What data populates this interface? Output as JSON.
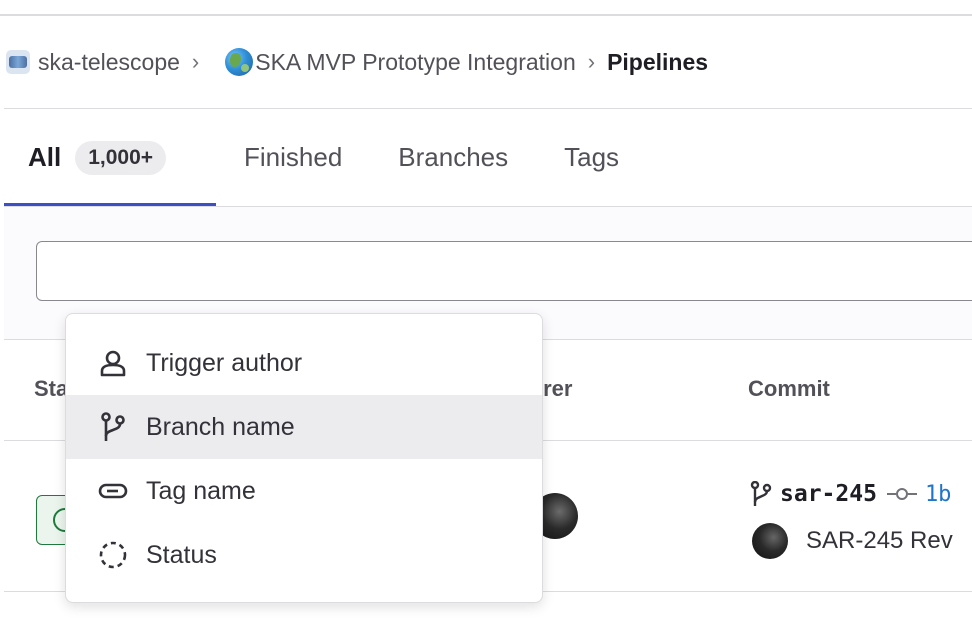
{
  "breadcrumb": {
    "items": [
      {
        "label": "ska-telescope",
        "avatar": "ska-telescope-avatar"
      },
      {
        "label": "SKA MVP Prototype Integration",
        "avatar": "globe-avatar"
      },
      {
        "label": "Pipelines"
      }
    ],
    "separator_icon": "chevron-right-icon"
  },
  "tabs": [
    {
      "label": "All",
      "count": "1,000+",
      "active": true
    },
    {
      "label": "Finished"
    },
    {
      "label": "Branches"
    },
    {
      "label": "Tags"
    }
  ],
  "filter": {
    "value": "",
    "placeholder": ""
  },
  "table": {
    "headers": {
      "status": "Sta",
      "triggerer": "ggerer",
      "commit": "Commit"
    },
    "rows": [
      {
        "ref": "sar-245",
        "sha": "1b",
        "message": "SAR-245 Rev"
      }
    ]
  },
  "dropdown": {
    "items": [
      {
        "label": "Trigger author",
        "icon": "user-icon"
      },
      {
        "label": "Branch name",
        "icon": "branch-icon",
        "highlighted": true
      },
      {
        "label": "Tag name",
        "icon": "tag-icon"
      },
      {
        "label": "Status",
        "icon": "status-icon"
      }
    ]
  },
  "colors": {
    "accent": "#3c4fc4",
    "link": "#1f75cb",
    "success": "#1f7a3d",
    "hover_bg": "#ececef"
  }
}
